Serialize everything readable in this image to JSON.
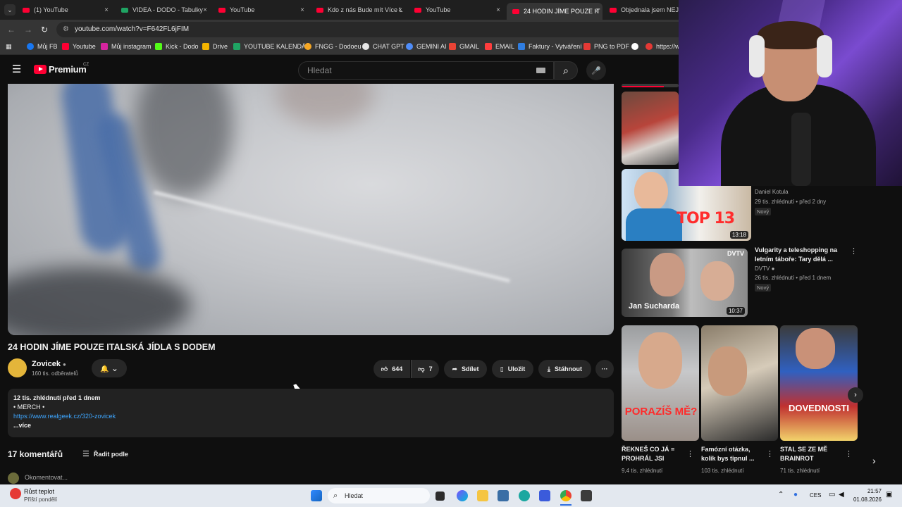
{
  "tabs": [
    {
      "label": "(1) YouTube",
      "icon": "youtube-icon"
    },
    {
      "label": "VIDEA - DODO - Tabulky",
      "icon": "sheets-icon"
    },
    {
      "label": "YouTube",
      "icon": "youtube-icon"
    },
    {
      "label": "Kdo z nás Bude mít Více L",
      "icon": "youtube-icon"
    },
    {
      "label": "YouTube",
      "icon": "youtube-icon"
    },
    {
      "label": "24 HODIN JÍME POUZE IT",
      "icon": "youtube-icon"
    },
    {
      "label": "Objednala jsem NEJHOR",
      "icon": "youtube-icon"
    }
  ],
  "tab_close_glyph": "×",
  "address_bar": {
    "url": "youtube.com/watch?v=F642FL6jFIM",
    "back": "←",
    "forward": "→",
    "reload": "↻",
    "site_icon": "⚙"
  },
  "bookmarks": [
    {
      "label": "Můj FB",
      "color": "#1877f2"
    },
    {
      "label": "Youtube",
      "color": "#ff0033"
    },
    {
      "label": "Můj instagram",
      "color": "#d6249f"
    },
    {
      "label": "Kick - Dodo",
      "color": "#53fc18"
    },
    {
      "label": "Drive",
      "color": "#f4b400"
    },
    {
      "label": "YOUTUBE KALENDÁŘ",
      "color": "#1fa463"
    },
    {
      "label": "FNGG - Dodoeu",
      "color": "#f5a623"
    },
    {
      "label": "CHAT GPT",
      "color": "#e6e6e6"
    },
    {
      "label": "GEMINI AI",
      "color": "#4f8df9"
    },
    {
      "label": "GMAIL",
      "color": "#ea4335"
    },
    {
      "label": "EMAIL",
      "color": "#ff3d3d"
    },
    {
      "label": "Faktury - Vytváření",
      "color": "#2f7de1"
    },
    {
      "label": "PNG to PDF",
      "color": "#e53935"
    },
    {
      "label": "",
      "color": "#ffffff"
    },
    {
      "label": "https://w",
      "color": "#e53935"
    }
  ],
  "masthead": {
    "logo": "Premium",
    "region": "CZ",
    "search_placeholder": "Hledat",
    "search_glyph": "⌕",
    "mic_glyph": "🎤",
    "menu_glyph": "☰"
  },
  "video": {
    "title": "24 HODIN JÍME POUZE ITALSKÁ JÍDLA S DODEM",
    "channel": "Zovicek",
    "subscribers": "160 tis. odběratelů",
    "likes": "644",
    "dislikes": "7",
    "share": "Sdílet",
    "save": "Uložit",
    "download": "Stáhnout",
    "more": "···",
    "bell": "🔔",
    "chevron": "⌄"
  },
  "description": {
    "stats": "12 tis. zhlédnutí  před 1 dnem",
    "merch": "• MERCH •",
    "link": "https://www.realgeek.cz/320-zovicek",
    "more": "...více"
  },
  "comments": {
    "count": "17 komentářů",
    "sort": "Řadit podle",
    "placeholder": "Okomentovat..."
  },
  "sidebar": {
    "video1": {
      "channel": "Daniel Kotula",
      "meta": "29 tis. zhlédnutí • před 2 dny",
      "badge": "Nový",
      "duration": "13:18",
      "thumb_text": "TOP 13"
    },
    "video2": {
      "title": "Vulgarity a teleshopping na letním táboře: Tary dělá ...",
      "channel": "DVTV",
      "meta": "26 tis. zhlédnutí • před 1 dnem",
      "badge": "Nový",
      "duration": "10:37",
      "thumb_name": "Jan Sucharda",
      "thumb_logo": "DVTV"
    },
    "shorts": [
      {
        "title": "ŘEKNEŠ CO JÁ = PROHRÁL JSI",
        "views": "9,4 tis. zhlédnutí",
        "thumb_text": "PORAZÍŠ MĚ?"
      },
      {
        "title": "Famózní otázka, kolik bys tipnul ...",
        "views": "103 tis. zhlédnutí",
        "thumb_text": ""
      },
      {
        "title": "STAL SE ZE MĚ BRAINROT",
        "views": "71 tis. zhlédnutí",
        "thumb_text": "DOVEDNOSTI"
      }
    ]
  },
  "taskbar": {
    "weather_title": "Růst teplot",
    "weather_sub": "Příští pondělí",
    "search": "Hledat",
    "lang": "CES",
    "time": "21:57",
    "date": "01.08.2026"
  }
}
